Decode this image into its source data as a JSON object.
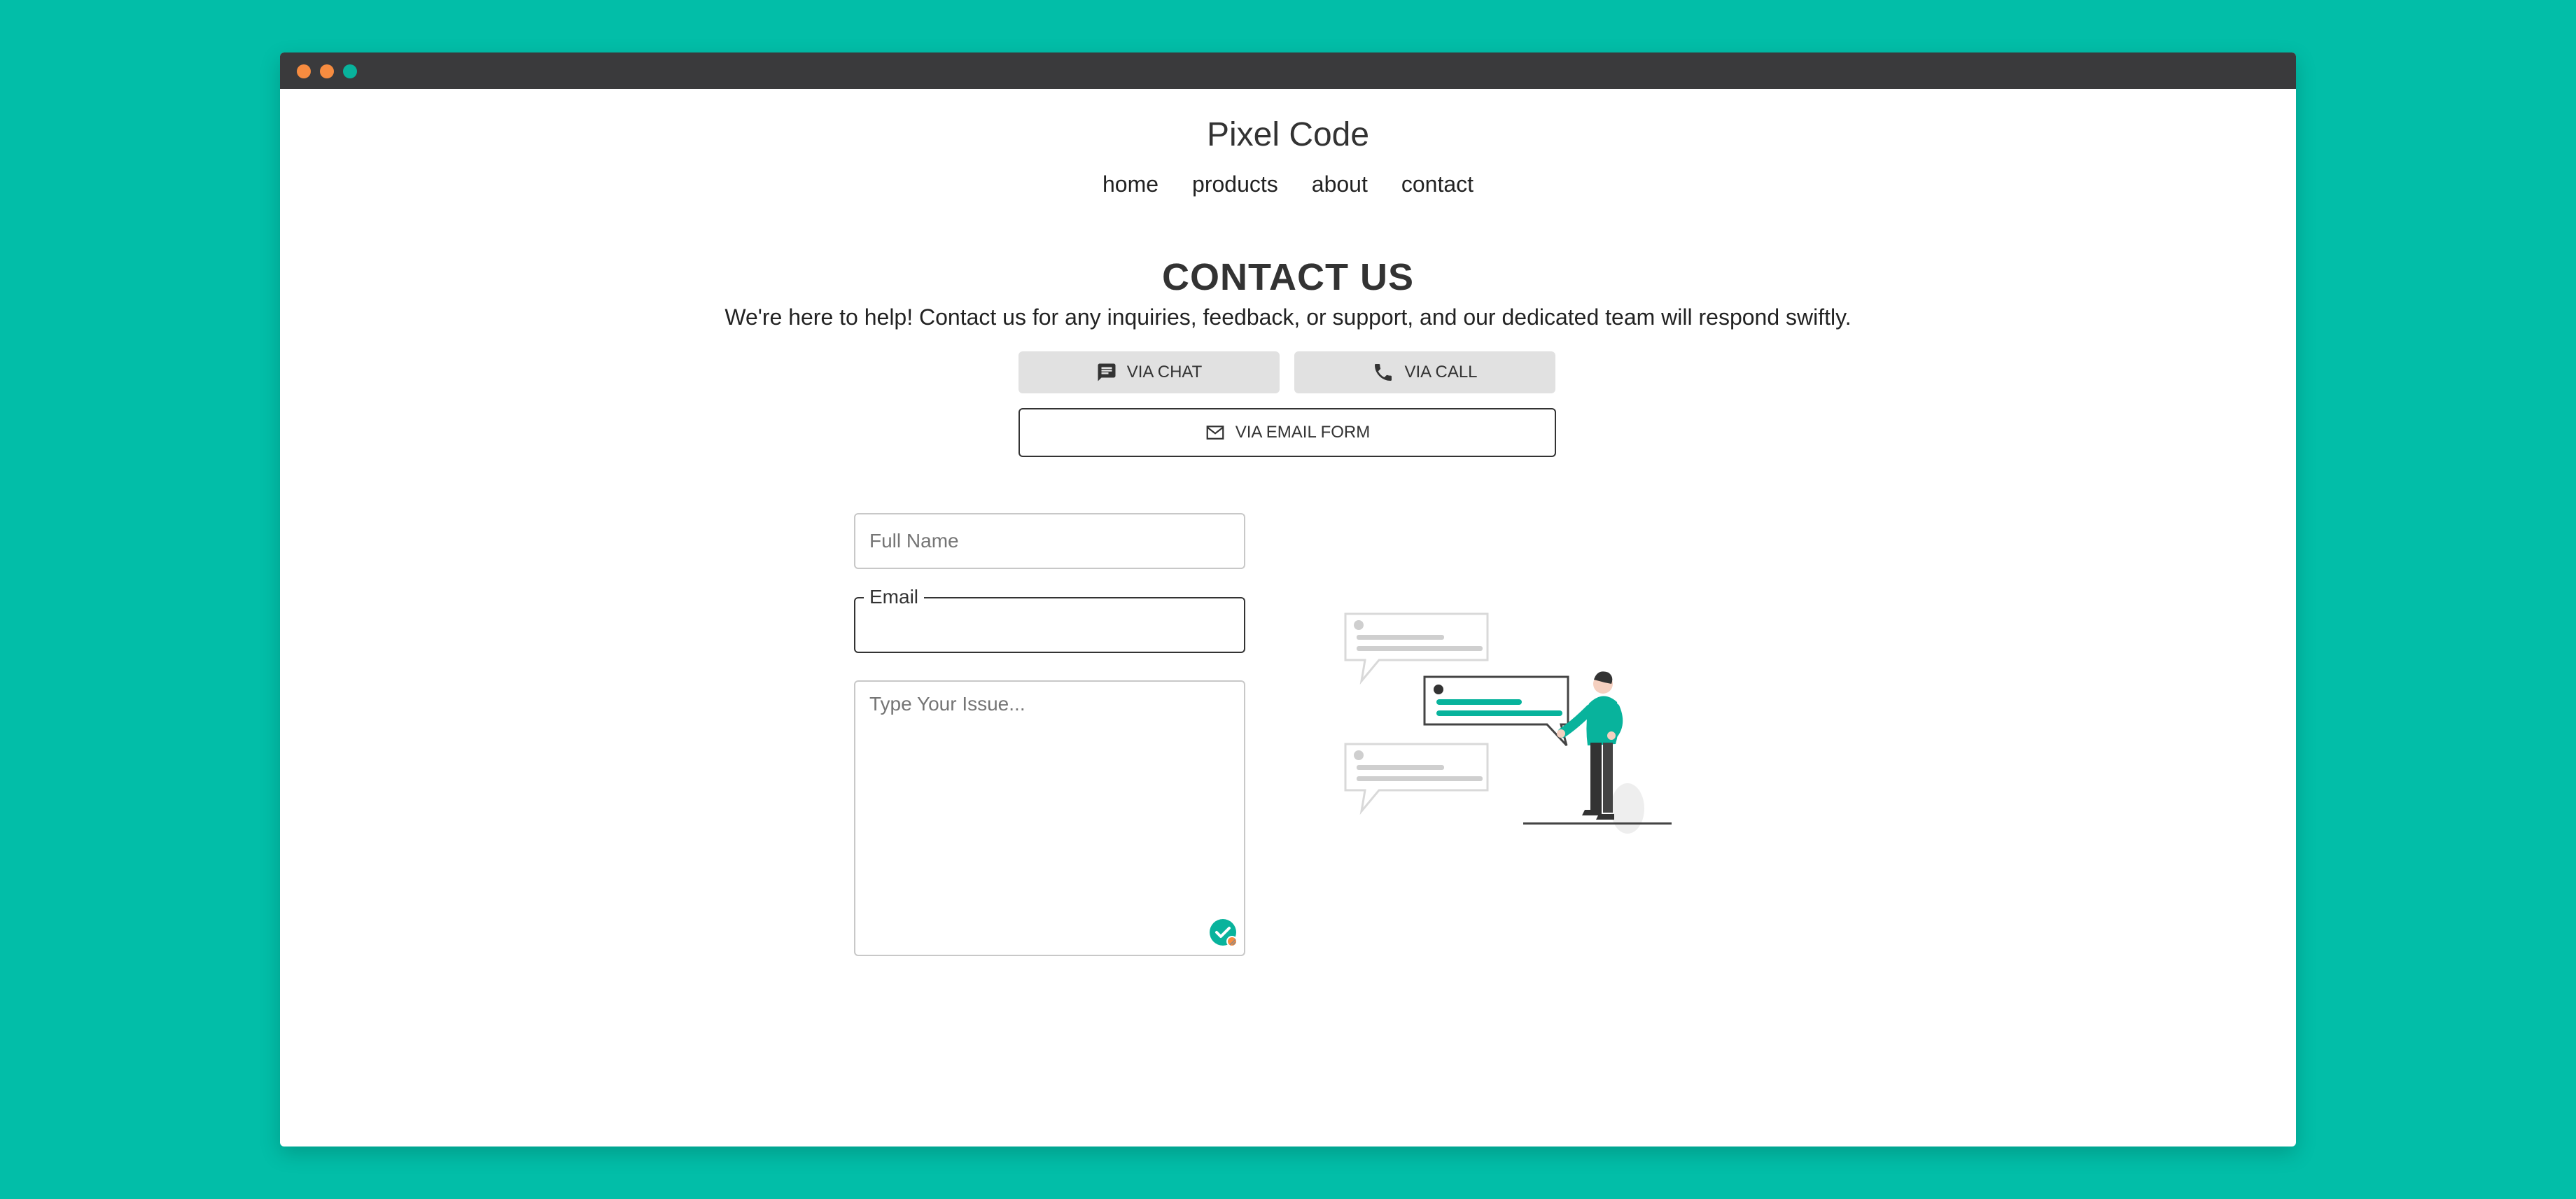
{
  "window": {
    "controls": [
      "close",
      "minimize",
      "maximize"
    ]
  },
  "site": {
    "title": "Pixel Code",
    "nav": [
      "home",
      "products",
      "about",
      "contact"
    ]
  },
  "contact": {
    "heading": "CONTACT US",
    "description": "We're here to help! Contact us for any inquiries, feedback, or support, and our dedicated team will respond swiftly.",
    "buttons": {
      "chat": "VIA CHAT",
      "call": "VIA CALL",
      "email": "VIA EMAIL FORM"
    },
    "icons": {
      "chat": "chat-icon",
      "call": "phone-icon",
      "email": "mail-icon"
    }
  },
  "form": {
    "full_name": {
      "placeholder": "Full Name",
      "value": ""
    },
    "email": {
      "label": "Email",
      "value": ""
    },
    "issue": {
      "placeholder": "Type Your Issue...",
      "value": ""
    }
  },
  "colors": {
    "background": "#02bea8",
    "accent": "#08b39c",
    "titlebar": "#3a3a3c",
    "button_grey": "#e1e1e1"
  }
}
